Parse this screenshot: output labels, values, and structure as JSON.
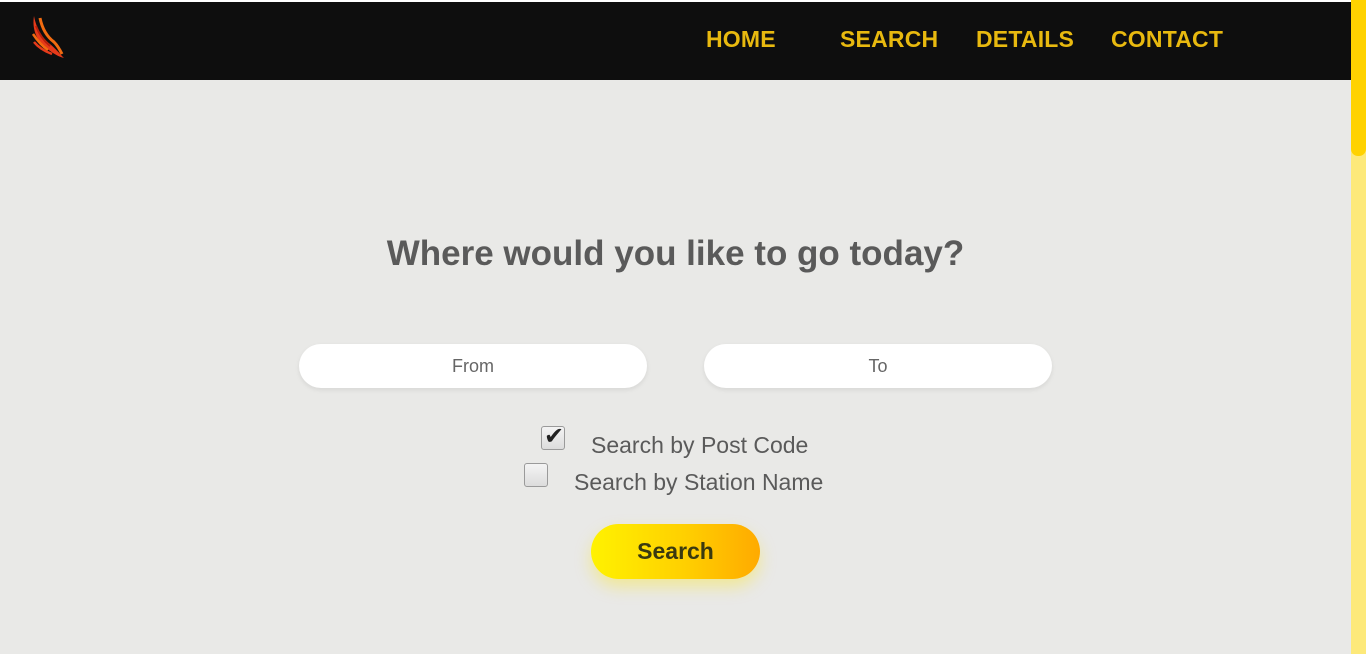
{
  "nav": {
    "items": [
      {
        "label": "HOME"
      },
      {
        "label": "SEARCH"
      },
      {
        "label": "DETAILS"
      },
      {
        "label": "CONTACT"
      }
    ]
  },
  "logo": {
    "icon": "wing-icon",
    "colors": [
      "#e63a1a",
      "#f26b10"
    ]
  },
  "main": {
    "headline": "Where would you like to go today?",
    "from": {
      "value": "",
      "placeholder": "From"
    },
    "to": {
      "value": "",
      "placeholder": "To"
    },
    "options": [
      {
        "label": "Search by Post Code",
        "checked": true
      },
      {
        "label": "Search by Station Name",
        "checked": false
      }
    ],
    "search_label": "Search"
  },
  "colors": {
    "nav_bg": "#0e0e0e",
    "nav_text": "#e8b90f",
    "page_bg": "#e9e9e7",
    "accent": "#ffd000"
  }
}
